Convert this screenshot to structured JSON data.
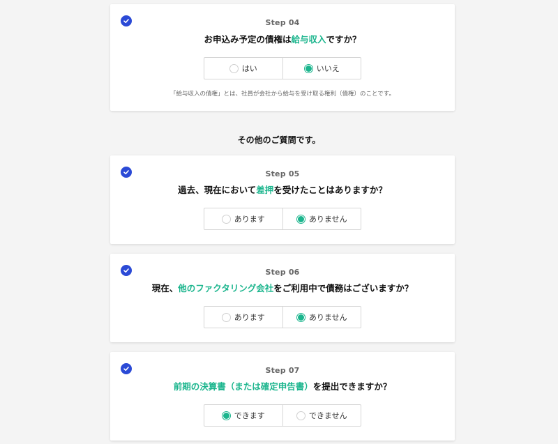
{
  "colors": {
    "accent": "#1bb58d",
    "check": "#2b4ad6"
  },
  "section_title": "その他のご質問です。",
  "cards": [
    {
      "step": "Step 04",
      "question_parts": [
        "お申込み予定の債権は",
        "給与収入",
        "ですか？"
      ],
      "options": [
        "はい",
        "いいえ"
      ],
      "selected_index": 1,
      "note": "「給与収入の債権」とは、社員が会社から給与を受け取る権利（債権）のことです。"
    },
    {
      "step": "Step 05",
      "question_parts": [
        "過去、現在において",
        "差押",
        "を受けたことはありますか？"
      ],
      "options": [
        "あります",
        "ありません"
      ],
      "selected_index": 1
    },
    {
      "step": "Step 06",
      "question_parts": [
        "現在、",
        "他のファクタリング会社",
        "をご利用中で債務はございますか？"
      ],
      "options": [
        "あります",
        "ありません"
      ],
      "selected_index": 1
    },
    {
      "step": "Step 07",
      "question_parts": [
        "",
        "前期の決算書（または確定申告書）",
        "を提出できますか？"
      ],
      "options": [
        "できます",
        "できません"
      ],
      "selected_index": 0
    }
  ]
}
